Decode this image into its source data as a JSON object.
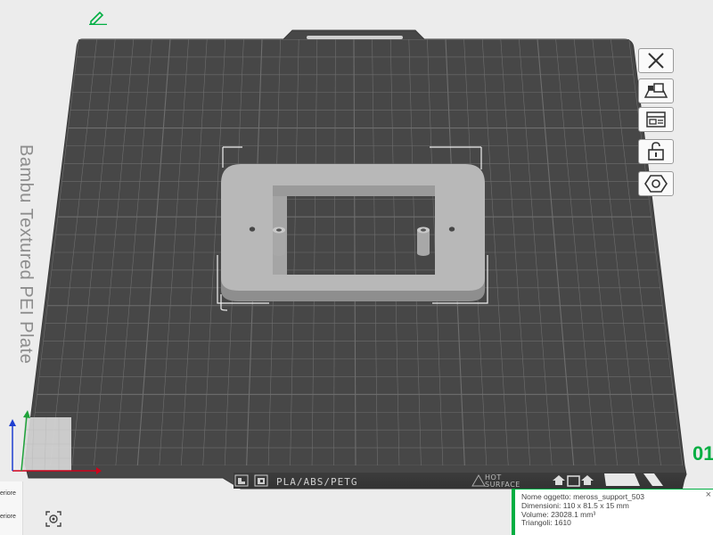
{
  "plate": {
    "title": "Bambu Textured PEI Plate",
    "filament_text": "PLA/ABS/PETG",
    "hot_surface_line1": "HOT",
    "hot_surface_line2": "SURFACE",
    "number": "01"
  },
  "toolbar": {
    "icons": [
      "close-icon",
      "arrange-icon",
      "layout-icon",
      "lock-icon",
      "settings-hex-icon"
    ]
  },
  "sidebar": {
    "label1": "eriore",
    "label2": "eriore"
  },
  "object_info": {
    "name": "Nome oggetto: meross_support_503",
    "dimensions": "Dimensioni: 110 x 81.5 x 15 mm",
    "volume": "Volume: 23028.1 mm³",
    "triangles": "Triangoli: 1610",
    "close": "×"
  },
  "colors": {
    "accent": "#00ae42",
    "plate": "#484848",
    "grid": "#6e6e6e",
    "model": "#b8b8b8"
  }
}
